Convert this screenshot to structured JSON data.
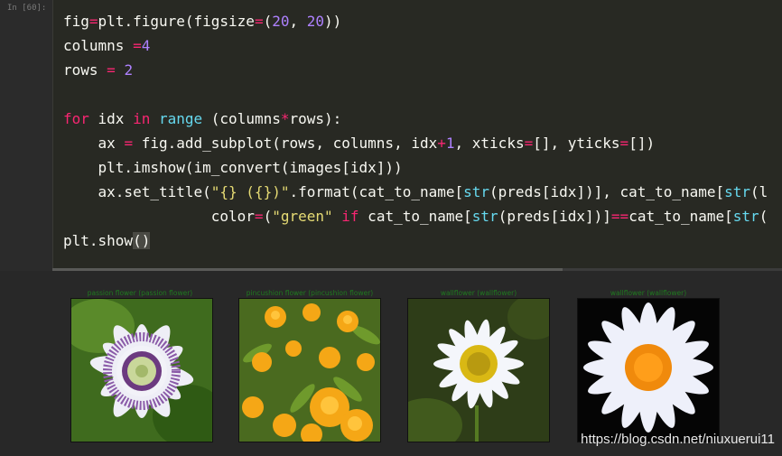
{
  "cell": {
    "prompt": "In [60]:",
    "code_lines": [
      "fig=plt.figure(figsize=(20, 20))",
      "columns =4",
      "rows = 2",
      "",
      "for idx in range (columns*rows):",
      "    ax = fig.add_subplot(rows, columns, idx+1, xticks=[], yticks=[])",
      "    plt.imshow(im_convert(images[idx]))",
      "    ax.set_title(\"{} ({})\".format(cat_to_name[str(preds[idx])], cat_to_name[str(l",
      "                 color=(\"green\" if cat_to_name[str(preds[idx])]==cat_to_name[str(",
      "plt.show()"
    ]
  },
  "output": {
    "panels": [
      {
        "title": "passion flower (passion flower)",
        "image": "passion-flower-photo"
      },
      {
        "title": "pincushion flower (pincushion flower)",
        "image": "orange-flowers-photo"
      },
      {
        "title": "wallflower (wallflower)",
        "image": "daisy-on-green-photo"
      },
      {
        "title": "wallflower (wallflower)",
        "image": "daisy-on-black-photo"
      }
    ],
    "title_color": "#1f7a1f"
  },
  "watermark": "https://blog.csdn.net/niuxuerui11"
}
